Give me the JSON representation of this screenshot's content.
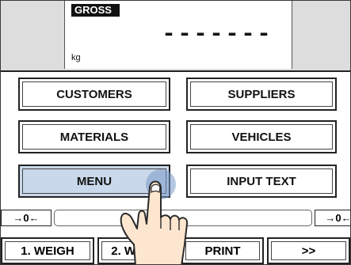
{
  "display": {
    "mode_label": "GROSS",
    "value": "-------",
    "unit": "kg"
  },
  "grid": {
    "customers": "CUSTOMERS",
    "suppliers": "SUPPLIERS",
    "materials": "MATERIALS",
    "vehicles": "VEHICLES",
    "menu": "MENU",
    "input_text": "INPUT TEXT"
  },
  "zero_bar": {
    "left_label": "→0←",
    "right_label": "→0←"
  },
  "nav": {
    "weigh1": "1. WEIGH",
    "weigh2": "2. WEIGH",
    "print": "PRINT",
    "more": ">>"
  },
  "colors": {
    "active_button": "#c9d8ea",
    "touch_indicator": "#789bc8"
  },
  "icons": {
    "pointer": "pointing-hand-icon",
    "touch": "touch-indicator-icon"
  }
}
